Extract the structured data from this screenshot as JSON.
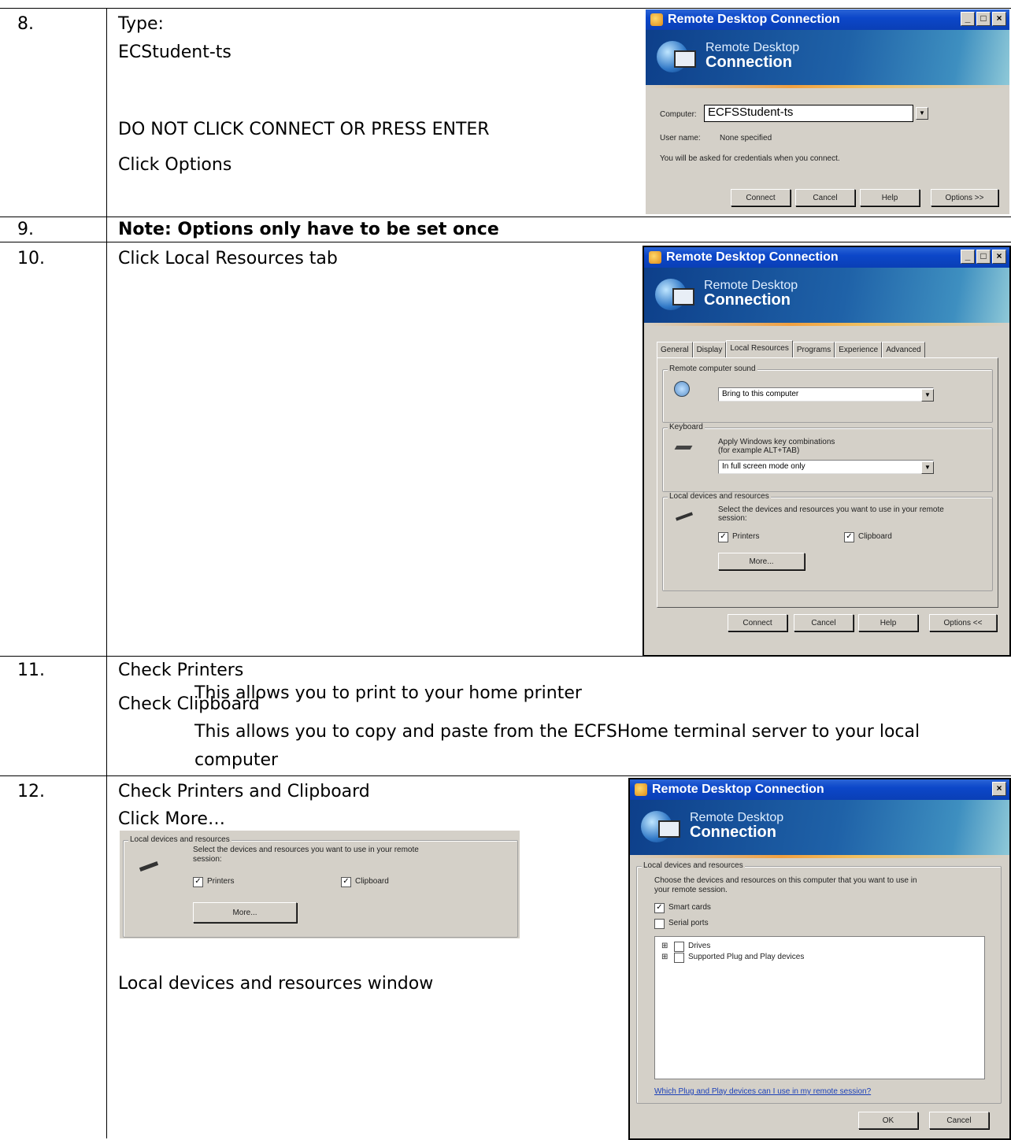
{
  "steps": [
    {
      "number": "8.",
      "lines": [
        "Type:",
        "ECStudent-ts",
        "DO NOT CLICK CONNECT OR PRESS ENTER",
        "Click Options"
      ]
    },
    {
      "number": "9.",
      "note": "Note: Options only have to be set once"
    },
    {
      "number": "10.",
      "lines": [
        "Click Local Resources tab"
      ]
    },
    {
      "number": "11.",
      "lines": [
        "Check Printers",
        "This allows you to print to your home printer",
        "Check Clipboard",
        "This allows you to copy and paste from the ECFSHome terminal server to your local",
        "computer"
      ]
    },
    {
      "number": "12.",
      "lines": [
        "Check Printers and Clipboard",
        "Click More…",
        "Local devices and resources window"
      ]
    }
  ],
  "dialog_common": {
    "title": "Remote Desktop Connection",
    "banner_line1": "Remote Desktop",
    "banner_line2": "Connection"
  },
  "dialog1": {
    "computer_label": "Computer:",
    "computer_value": "ECFSStudent-ts",
    "username_label": "User name:",
    "username_value": "None specified",
    "credentials_note": "You will be asked for credentials when you connect.",
    "buttons": [
      "Connect",
      "Cancel",
      "Help",
      "Options >>"
    ]
  },
  "dialog2": {
    "tabs": [
      "General",
      "Display",
      "Local Resources",
      "Programs",
      "Experience",
      "Advanced"
    ],
    "sound_group": "Remote computer sound",
    "sound_value": "Bring to this computer",
    "keyboard_group": "Keyboard",
    "keyboard_text1": "Apply Windows key combinations",
    "keyboard_text2": "(for example ALT+TAB)",
    "keyboard_value": "In full screen mode only",
    "devices_group": "Local devices and resources",
    "devices_text1": "Select the devices and resources you want to use in your remote",
    "devices_text2": "session:",
    "printers": "Printers",
    "clipboard": "Clipboard",
    "more": "More...",
    "buttons": [
      "Connect",
      "Cancel",
      "Help",
      "Options <<"
    ]
  },
  "snippet": {
    "group": "Local devices and resources",
    "text1": "Select the devices and resources you want to use in your remote",
    "text2": "session:",
    "printers": "Printers",
    "clipboard": "Clipboard",
    "more": "More..."
  },
  "dialog3": {
    "group": "Local devices and resources",
    "text1": "Choose the devices and resources on this computer that you want to use in",
    "text2": "your remote session.",
    "smart_cards": "Smart cards",
    "serial_ports": "Serial ports",
    "tree": [
      "Drives",
      "Supported Plug and Play devices"
    ],
    "link": "Which Plug and Play devices can I use in my remote session?",
    "buttons": [
      "OK",
      "Cancel"
    ]
  }
}
